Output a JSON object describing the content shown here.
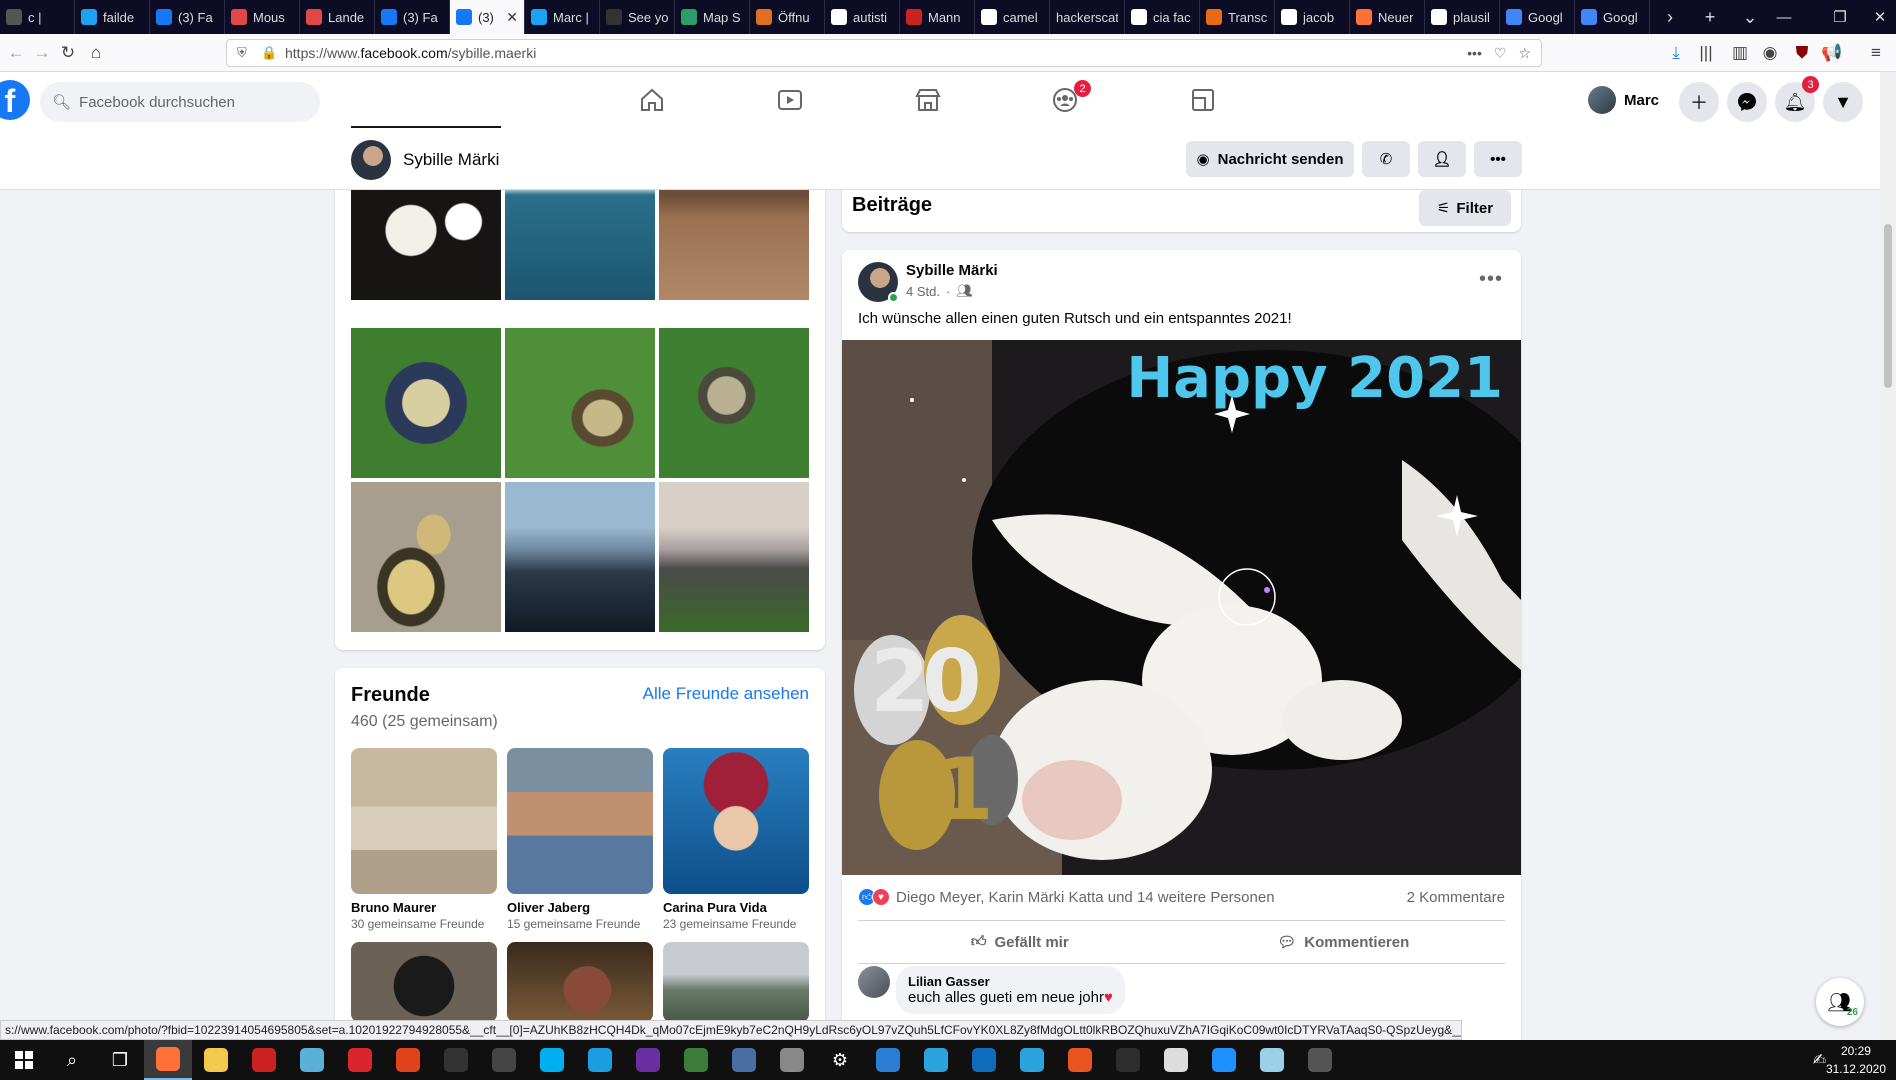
{
  "browser": {
    "tabs": [
      {
        "label": "c |",
        "icon": "tab-icon-generic",
        "color": "#555555"
      },
      {
        "label": "failde",
        "icon": "twitter-icon",
        "color": "#1da1f2"
      },
      {
        "label": "(3) Fa",
        "icon": "facebook-icon",
        "color": "#1877f2"
      },
      {
        "label": "Mous",
        "icon": "tab-icon-red",
        "color": "#e04848"
      },
      {
        "label": "Lande",
        "icon": "tab-icon-red",
        "color": "#e04848"
      },
      {
        "label": "(3) Fa",
        "icon": "facebook-icon",
        "color": "#1877f2"
      },
      {
        "label": "(3)",
        "icon": "facebook-icon",
        "color": "#1877f2",
        "active": true
      },
      {
        "label": "Marc |",
        "icon": "twitter-icon",
        "color": "#1da1f2"
      },
      {
        "label": "See yo",
        "icon": "github-icon",
        "color": "#333333"
      },
      {
        "label": "Map S",
        "icon": "map-icon",
        "color": "#2e9b6b"
      },
      {
        "label": "Öffnu",
        "icon": "tab-icon-orange",
        "color": "#e07020"
      },
      {
        "label": "autisti",
        "icon": "google-icon",
        "color": "#ffffff"
      },
      {
        "label": "Mann",
        "icon": "tab-icon-red",
        "color": "#cc2222"
      },
      {
        "label": "camel",
        "icon": "google-icon",
        "color": "#ffffff"
      },
      {
        "label": "hackerscat",
        "icon": "",
        "color": ""
      },
      {
        "label": "cia fac",
        "icon": "google-icon",
        "color": "#ffffff"
      },
      {
        "label": "Transc",
        "icon": "tab-icon-orange",
        "color": "#e86a17"
      },
      {
        "label": "jacob",
        "icon": "google-icon",
        "color": "#ffffff"
      },
      {
        "label": "Neuer",
        "icon": "firefox-icon",
        "color": "#ff7139"
      },
      {
        "label": "plausil",
        "icon": "google-icon",
        "color": "#ffffff"
      },
      {
        "label": "Googl",
        "icon": "translate-icon",
        "color": "#4285f4"
      },
      {
        "label": "Googl",
        "icon": "translate-icon",
        "color": "#4285f4"
      }
    ],
    "url_prefix": "https://www.",
    "url_host": "facebook.com",
    "url_path": "/sybille.maerki",
    "status_url": "s://www.facebook.com/photo/?fbid=10223914054695805&set=a.10201922794928055&__cft__[0]=AZUhKB8zHCQH4Dk_qMo07cEjmE9kyb7eC2nQH9yLdRsc6yOL97vZQuh5LfCFovYK0XL8Zy8fMdgOLtt0lkRBOZQhuxuVZhA7IGqiKoC09wt0IcDTYRVaTAaqS0-QSpzUeyg&__tn__=EH-R"
  },
  "fb": {
    "search_placeholder": "Facebook durchsuchen",
    "groups_badge": "2",
    "user_name": "Marc",
    "notifications_badge": "3",
    "profile": {
      "name": "Sybille Märki",
      "message_btn": "Nachricht senden"
    },
    "friends": {
      "title": "Freunde",
      "see_all": "Alle Freunde ansehen",
      "count": "460 (25 gemeinsam)",
      "items": [
        {
          "name": "Bruno Maurer",
          "mutual": "30 gemeinsame Freunde"
        },
        {
          "name": "Oliver Jaberg",
          "mutual": "15 gemeinsame Freunde"
        },
        {
          "name": "Carina Pura Vida",
          "mutual": "23 gemeinsame Freunde"
        }
      ]
    },
    "posts": {
      "title": "Beiträge",
      "filter": "Filter"
    },
    "post": {
      "author": "Sybille Märki",
      "time": "4 Std.",
      "text": "Ich wünsche allen einen guten Rutsch und ein entspanntes 2021!",
      "image_text": "Happy 2021",
      "balloon_top": "20",
      "balloon_bottom": "21",
      "reactors": "Diego Meyer, Karin Märki Katta und 14 weitere Personen",
      "comments": "2 Kommentare",
      "like": "Gefällt mir",
      "comment": "Kommentieren"
    },
    "comment": {
      "name": "Lilian Gasser",
      "text": "euch alles gueti em neue johr"
    },
    "chat_count": "26"
  },
  "taskbar": {
    "time": "20:29",
    "date": "31.12.2020",
    "apps": [
      {
        "name": "search-icon",
        "glyph": "⌕",
        "color": ""
      },
      {
        "name": "task-view-icon",
        "glyph": "❐",
        "color": ""
      },
      {
        "name": "firefox-icon",
        "glyph": "",
        "color": "#ff7139",
        "active": true
      },
      {
        "name": "folder-icon",
        "glyph": "",
        "color": "#f2c94c"
      },
      {
        "name": "weather-app-icon",
        "glyph": "",
        "color": "#cc2222"
      },
      {
        "name": "chat-app-icon",
        "glyph": "",
        "color": "#5ab0d8"
      },
      {
        "name": "red-c-app-icon",
        "glyph": "",
        "color": "#d9262e"
      },
      {
        "name": "hexagon-app-icon",
        "glyph": "",
        "color": "#e0431b"
      },
      {
        "name": "live-app-icon",
        "glyph": "",
        "color": "#333333"
      },
      {
        "name": "wave-app-icon",
        "glyph": "",
        "color": "#444444"
      },
      {
        "name": "skype-icon",
        "glyph": "",
        "color": "#00aff0"
      },
      {
        "name": "edge-icon",
        "glyph": "",
        "color": "#1b9de2"
      },
      {
        "name": "purple-app-icon",
        "glyph": "",
        "color": "#6a2fa0"
      },
      {
        "name": "plant-app-icon",
        "glyph": "",
        "color": "#3c7d3c"
      },
      {
        "name": "tool-app-icon",
        "glyph": "",
        "color": "#4a6fa5"
      },
      {
        "name": "window-app-icon",
        "glyph": "",
        "color": "#888888"
      },
      {
        "name": "settings-icon",
        "glyph": "⚙",
        "color": ""
      },
      {
        "name": "cloud-app-icon",
        "glyph": "",
        "color": "#2b7cd3"
      },
      {
        "name": "telegram-icon",
        "glyph": "",
        "color": "#2aa3df"
      },
      {
        "name": "outlook-icon",
        "glyph": "",
        "color": "#0f6cbd"
      },
      {
        "name": "telegram-badge-icon",
        "glyph": "",
        "color": "#2aa3df"
      },
      {
        "name": "ubuntu-icon",
        "glyph": "",
        "color": "#e95420"
      },
      {
        "name": "terminal-icon",
        "glyph": "",
        "color": "#2d2d2d"
      },
      {
        "name": "notepad-icon",
        "glyph": "",
        "color": "#dddddd"
      },
      {
        "name": "photos-icon",
        "glyph": "",
        "color": "#1e90ff"
      },
      {
        "name": "gem-app-icon",
        "glyph": "",
        "color": "#9ad0e8"
      },
      {
        "name": "up-arrow-app-icon",
        "glyph": "",
        "color": "#555555"
      }
    ]
  }
}
